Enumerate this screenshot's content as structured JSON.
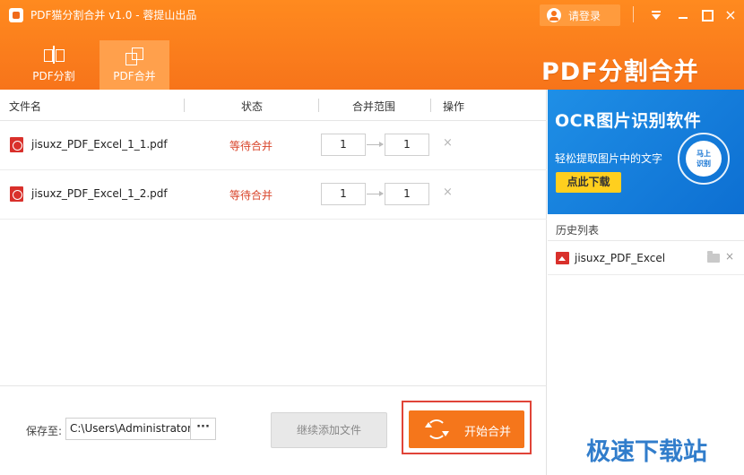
{
  "window": {
    "title": "PDF猫分割合并 v1.0 - 蓉提山出品",
    "login_label": "请登录",
    "close_glyph": "×"
  },
  "tabs": [
    {
      "label": "PDF分割",
      "icon": "split-icon"
    },
    {
      "label": "PDF合并",
      "icon": "merge-icon",
      "active": true
    }
  ],
  "brand_title": "PDF分割合并",
  "table": {
    "headers": {
      "filename": "文件名",
      "status": "状态",
      "range": "合并范围",
      "action": "操作"
    },
    "rows": [
      {
        "filename": "jisuxz_PDF_Excel_1_1.pdf",
        "status": "等待合并",
        "range_from": "1",
        "range_to": "1",
        "delete_glyph": "×"
      },
      {
        "filename": "jisuxz_PDF_Excel_1_2.pdf",
        "status": "等待合并",
        "range_from": "1",
        "range_to": "1",
        "delete_glyph": "×"
      }
    ]
  },
  "footer": {
    "save_label": "保存至:",
    "save_path": "C:\\Users\\Administrator",
    "browse_label": "···",
    "add_files_label": "继续添加文件",
    "start_label": "开始合并"
  },
  "ad": {
    "title": "OCR图片识别软件",
    "subtitle": "轻松提取图片中的文字",
    "button": "点此下载",
    "circle_text": "马上\n识别"
  },
  "history": {
    "title": "历史列表",
    "items": [
      {
        "name": "jisuxz_PDF_Excel",
        "close_glyph": "×"
      }
    ]
  },
  "watermark": "极速下载站",
  "colors": {
    "accent": "#f7741a",
    "status": "#d9452b",
    "ad_blue": "#0d6fd2",
    "highlight": "#e04438"
  }
}
